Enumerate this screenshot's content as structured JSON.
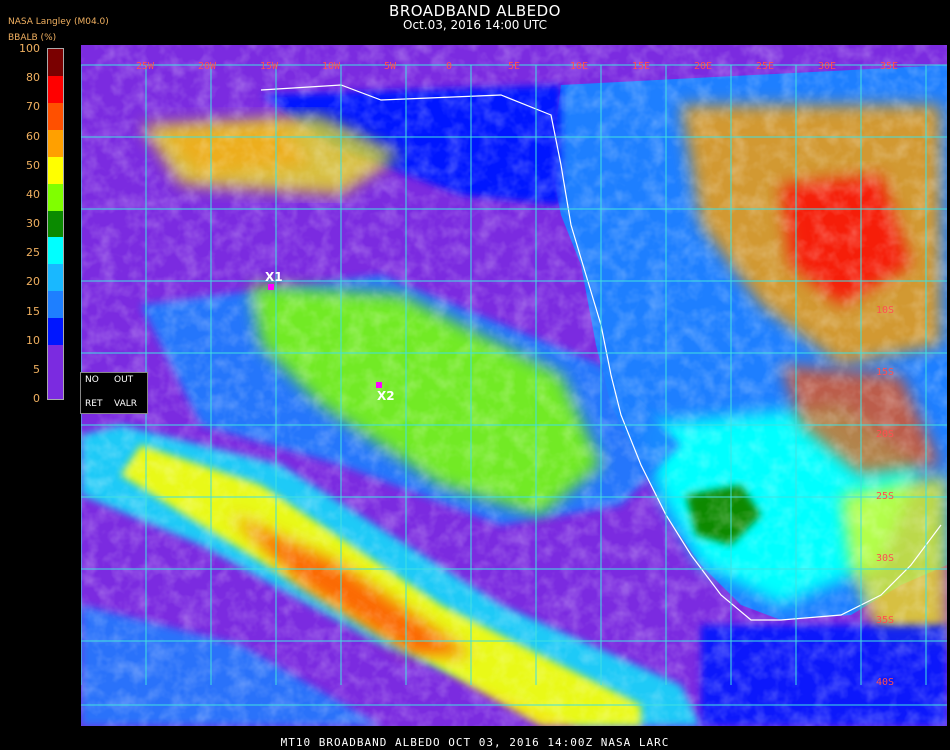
{
  "header": {
    "title": "BROADBAND ALBEDO",
    "subtitle": "Oct.03, 2016 14:00 UTC",
    "source": "NASA Langley (M04.0)"
  },
  "legend": {
    "title": "BBALB (%)",
    "ticks": [
      "100",
      "80",
      "70",
      "60",
      "50",
      "40",
      "30",
      "25",
      "20",
      "15",
      "10",
      "5",
      "0"
    ],
    "bins": [
      {
        "from": 0,
        "to": 5,
        "color": "#7b2be0"
      },
      {
        "from": 5,
        "to": 10,
        "color": "#7b2be0"
      },
      {
        "from": 10,
        "to": 15,
        "color": "#0016ff"
      },
      {
        "from": 15,
        "to": 20,
        "color": "#1e7fff"
      },
      {
        "from": 20,
        "to": 25,
        "color": "#19b8ff"
      },
      {
        "from": 25,
        "to": 30,
        "color": "#00ffff"
      },
      {
        "from": 30,
        "to": 40,
        "color": "#0a8a00"
      },
      {
        "from": 40,
        "to": 50,
        "color": "#80ff00"
      },
      {
        "from": 50,
        "to": 60,
        "color": "#ffff00"
      },
      {
        "from": 60,
        "to": 70,
        "color": "#ffa000"
      },
      {
        "from": 70,
        "to": 80,
        "color": "#ff5000"
      },
      {
        "from": 80,
        "to": 90,
        "color": "#ff0000"
      },
      {
        "from": 90,
        "to": 100,
        "color": "#7a0000"
      }
    ]
  },
  "nodata": {
    "no": "NO",
    "out": "OUT",
    "ret": "RET",
    "valr": "VALR"
  },
  "map": {
    "lon_labels": [
      "25W",
      "20W",
      "15W",
      "10W",
      "5W",
      "0",
      "5E",
      "10E",
      "15E",
      "20E",
      "25E",
      "30E",
      "35E"
    ],
    "lat_labels": [
      "10S",
      "15S",
      "20S",
      "25S",
      "30S",
      "35S",
      "40S"
    ],
    "markers": [
      {
        "label": "X1",
        "color": "#ff00ff"
      },
      {
        "label": "X2",
        "color": "#ff00ff"
      }
    ],
    "grid_color": "#40e0e0",
    "coast_color": "#ffffff"
  },
  "footer": {
    "text": "MT10  BROADBAND ALBEDO   OCT 03, 2016 14:00Z   NASA LARC"
  }
}
